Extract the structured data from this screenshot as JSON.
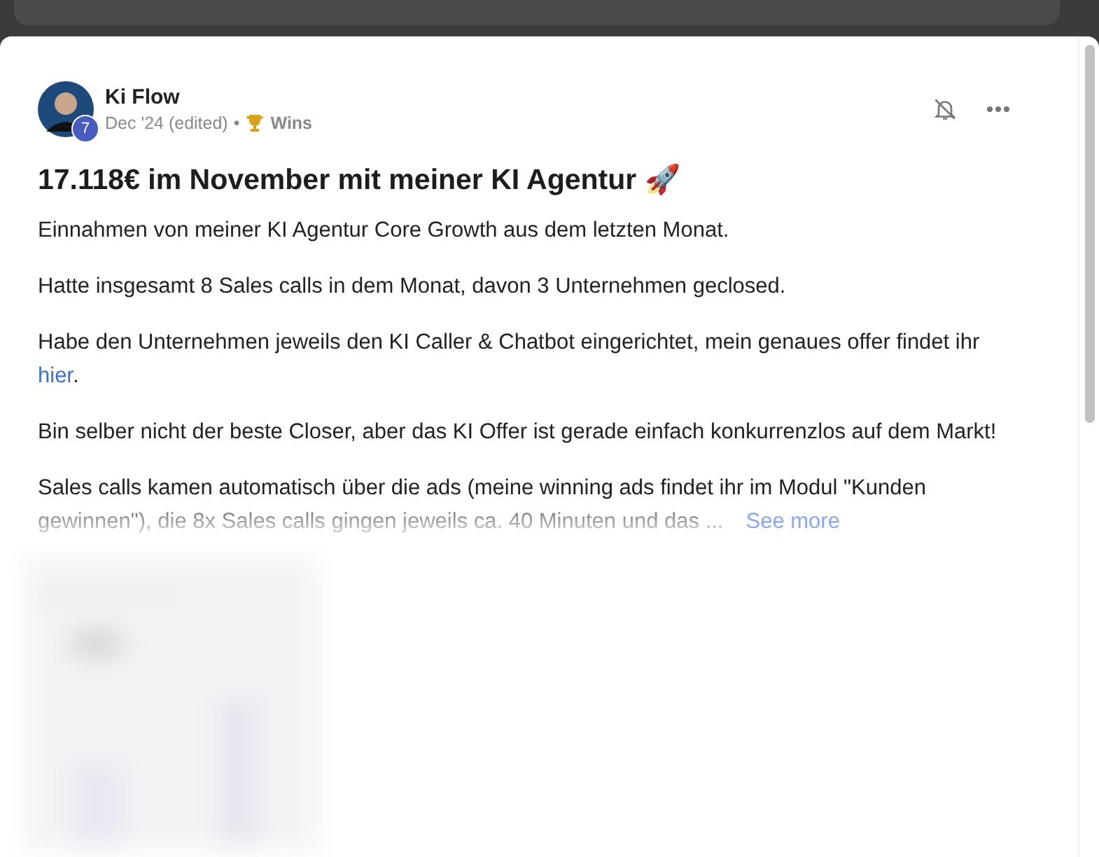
{
  "post": {
    "author": "Ki Flow",
    "level_badge": "7",
    "date": "Dec '24 (edited)",
    "separator": "•",
    "category": "Wins",
    "title": "17.118€ im November mit meiner KI Agentur 🚀",
    "paragraphs": [
      {
        "text": "Einnahmen von meiner KI Agentur Core Growth aus dem letzten Monat."
      },
      {
        "text": "Hatte insgesamt 8 Sales calls in dem Monat, davon 3 Unternehmen geclosed."
      },
      {
        "text": "Habe den Unternehmen jeweils den KI Caller & Chatbot eingerichtet, mein genaues offer findet ihr",
        "link": "hier",
        "after": "."
      },
      {
        "text": "Bin selber nicht der beste Closer, aber das KI Offer ist gerade einfach konkurrenzlos auf dem Markt!"
      },
      {
        "lines": [
          "Sales calls kamen automatisch über die ads (meine winning ads findet ihr im Modul \"Kunden",
          "gewinnen\"), die 8x Sales calls gingen jeweils ca. 40 Minuten und das ..."
        ]
      }
    ],
    "see_more": "See more"
  }
}
